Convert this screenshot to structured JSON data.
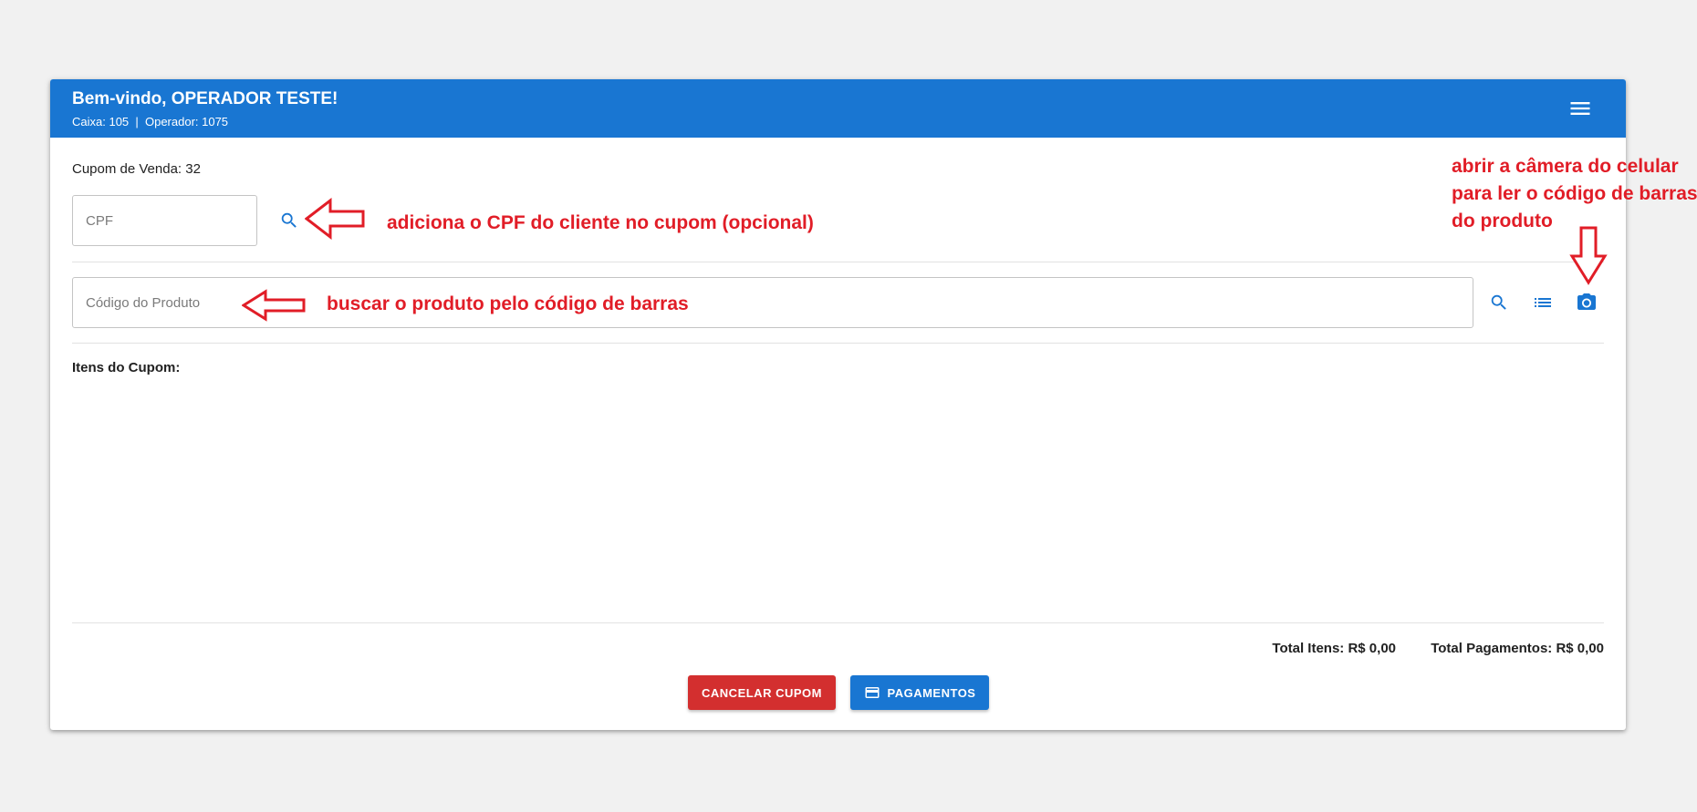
{
  "header": {
    "title": "Bem-vindo, OPERADOR TESTE!",
    "subtitle": "Caixa: 105  |  Operador: 1075",
    "menu_icon": "menu-icon"
  },
  "main": {
    "cupom_label": "Cupom de Venda: 32",
    "cpf": {
      "placeholder": "CPF",
      "value": "",
      "search_icon": "search-icon"
    },
    "product": {
      "placeholder": "Código do Produto",
      "value": "",
      "icons": [
        "search-icon",
        "list-icon",
        "camera-icon"
      ]
    },
    "itens_label": "Itens do Cupom:",
    "totals": {
      "itens": "Total Itens: R$ 0,00",
      "pagamentos": "Total Pagamentos: R$ 0,00"
    },
    "buttons": {
      "cancel_label": "CANCELAR CUPOM",
      "pay_label": "PAGAMENTOS",
      "pay_icon": "credit-card-icon"
    }
  },
  "annotations": {
    "cpf_note": "adiciona o CPF do cliente no cupom (opcional)",
    "product_note": "buscar o produto pelo código de barras",
    "camera_note": "abrir a câmera do celular para ler o código de barras do produto"
  },
  "colors": {
    "primary": "#1976d2",
    "danger": "#d32f2f",
    "annotation": "#e11d27",
    "background": "#f1f1f1"
  }
}
